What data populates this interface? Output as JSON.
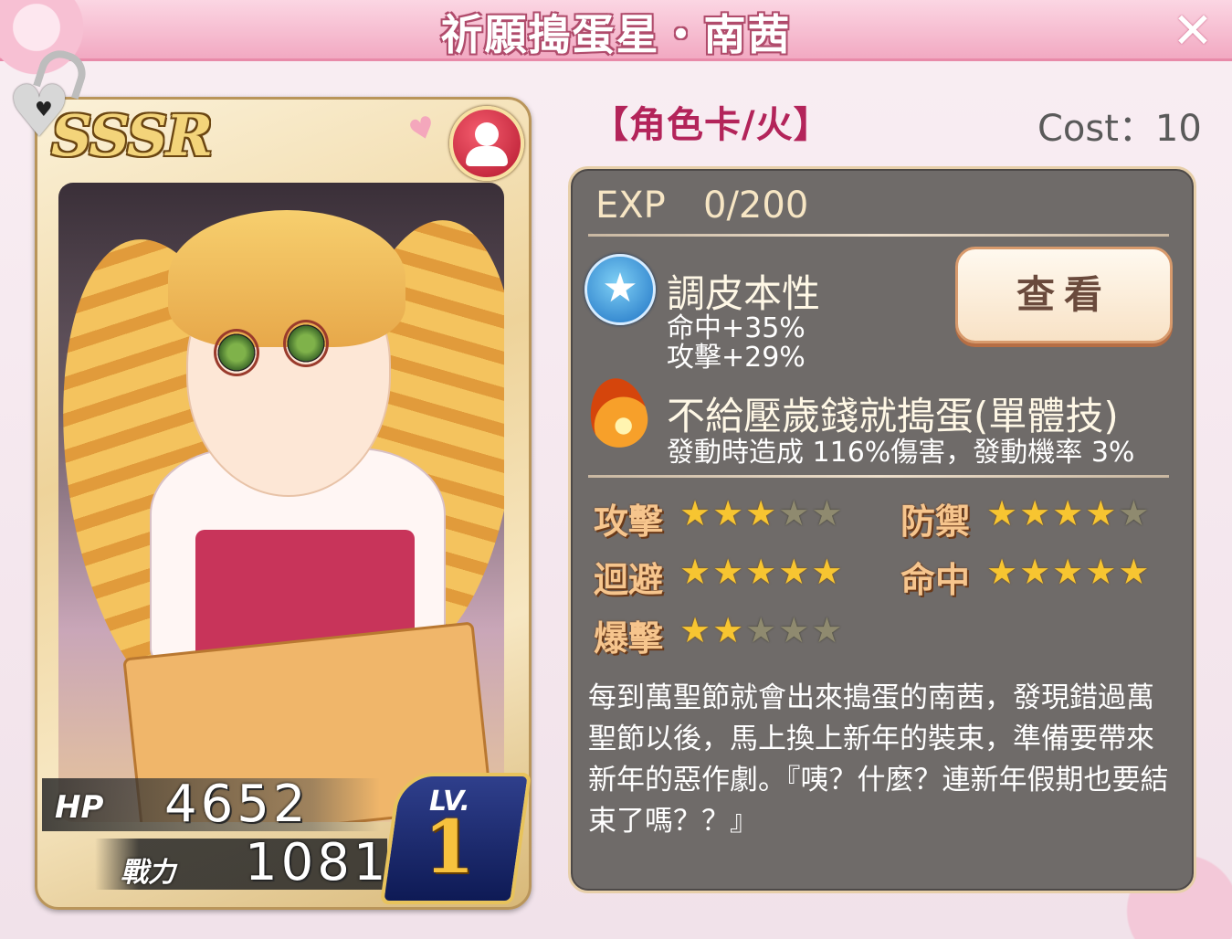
{
  "window": {
    "title": "祈願搗蛋星・南茜",
    "close_label": "✕"
  },
  "card": {
    "rarity": "SSSR",
    "hp_label": "HP",
    "hp_value": "4652",
    "power_label": "戰力",
    "power_value": "1081",
    "lv_label": "LV.",
    "lv_value": "1"
  },
  "info": {
    "card_type": "【角色卡/火】",
    "cost": "Cost：10",
    "exp_label": "EXP",
    "exp_value": "0/200",
    "view_button": "查看"
  },
  "skills": {
    "passive": {
      "icon": "blue-star-icon",
      "name": "調皮本性",
      "line1": "命中+35%",
      "line2": "攻擊+29%"
    },
    "active": {
      "icon": "fire-icon",
      "name": "不給壓歲錢就搗蛋(單體技)",
      "line1": "發動時造成 116%傷害，發動機率 3%"
    }
  },
  "stats": [
    {
      "label": "攻擊",
      "stars": 3,
      "max": 5
    },
    {
      "label": "防禦",
      "stars": 4,
      "max": 5
    },
    {
      "label": "迴避",
      "stars": 5,
      "max": 5
    },
    {
      "label": "命中",
      "stars": 5,
      "max": 5
    },
    {
      "label": "爆擊",
      "stars": 2,
      "max": 5
    }
  ],
  "description": "每到萬聖節就會出來搗蛋的南茜，發現錯過萬聖節以後，馬上換上新年的裝束，準備要帶來新年的惡作劇。『咦？什麼？連新年假期也要結束了嗎？？』",
  "colors": {
    "title_bar": "#f2a9c2",
    "panel_bg": "#6f6b69",
    "card_type": "#b3245a",
    "star_on": "#f7c531",
    "star_off": "#8f8a6f"
  }
}
